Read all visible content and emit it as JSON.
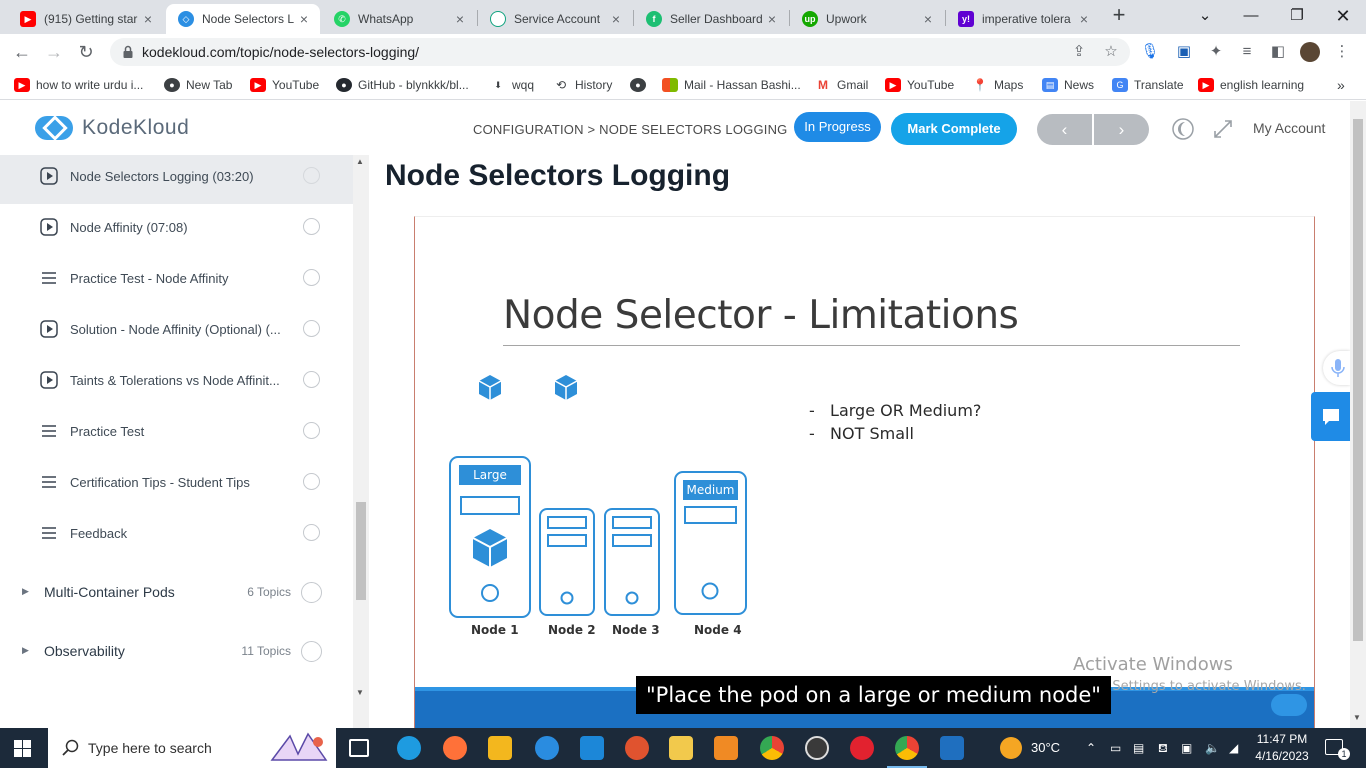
{
  "browser": {
    "tabs": [
      {
        "title": "(915) Getting star",
        "icon": "youtube-icon",
        "color": "#ff0000"
      },
      {
        "title": "Node Selectors L",
        "icon": "kodekloud-icon",
        "color": "#2c8fe3"
      },
      {
        "title": "WhatsApp",
        "icon": "whatsapp-icon",
        "color": "#25d366"
      },
      {
        "title": "Service Account",
        "icon": "openai-icon",
        "color": "#10a37f"
      },
      {
        "title": "Seller Dashboard",
        "icon": "fiverr-icon",
        "color": "#1dbf73"
      },
      {
        "title": "Upwork",
        "icon": "upwork-icon",
        "color": "#14a800"
      },
      {
        "title": "imperative tolera",
        "icon": "yahoo-icon",
        "color": "#6001d2"
      }
    ],
    "url": "kodekloud.com/topic/node-selectors-logging/",
    "bookmarks": [
      {
        "label": "how to write urdu i...",
        "icon": "youtube-icon"
      },
      {
        "label": "New Tab",
        "icon": "globe-icon"
      },
      {
        "label": "YouTube",
        "icon": "youtube-icon"
      },
      {
        "label": "GitHub - blynkkk/bl...",
        "icon": "github-icon"
      },
      {
        "label": "wqq",
        "icon": "download-icon"
      },
      {
        "label": "History",
        "icon": "history-icon"
      },
      {
        "label": "",
        "icon": "globe-icon"
      },
      {
        "label": "Mail - Hassan Bashi...",
        "icon": "microsoft-icon"
      },
      {
        "label": "Gmail",
        "icon": "gmail-icon"
      },
      {
        "label": "YouTube",
        "icon": "youtube-icon"
      },
      {
        "label": "Maps",
        "icon": "maps-icon"
      },
      {
        "label": "News",
        "icon": "news-icon"
      },
      {
        "label": "Translate",
        "icon": "translate-icon"
      },
      {
        "label": "english learning",
        "icon": "youtube-icon"
      }
    ]
  },
  "header": {
    "logo": "KodeKloud",
    "breadcrumb": "CONFIGURATION > NODE SELECTORS LOGGING",
    "status_button": "In Progress",
    "complete_button": "Mark Complete",
    "prev": "‹",
    "next": "›",
    "account": "My Account"
  },
  "sidebar": {
    "items": [
      {
        "label": "Node Selectors Logging (03:20)",
        "type": "video",
        "active": true
      },
      {
        "label": "Node Affinity (07:08)",
        "type": "video"
      },
      {
        "label": "Practice Test - Node Affinity",
        "type": "lab"
      },
      {
        "label": "Solution - Node Affinity (Optional) (...",
        "type": "video"
      },
      {
        "label": "Taints & Tolerations vs Node Affinit...",
        "type": "video"
      },
      {
        "label": "Practice Test",
        "type": "lab"
      },
      {
        "label": "Certification Tips - Student Tips",
        "type": "lab"
      },
      {
        "label": "Feedback",
        "type": "lab"
      }
    ],
    "sections": [
      {
        "label": "Multi-Container Pods",
        "count": "6 Topics"
      },
      {
        "label": "Observability",
        "count": "11 Topics"
      }
    ]
  },
  "main": {
    "title": "Node Selectors Logging",
    "slide": {
      "title": "Node Selector - Limitations",
      "bullets": [
        "Large OR Medium?",
        "NOT Small"
      ],
      "large_tag": "Large",
      "medium_tag": "Medium",
      "nodes": [
        "Node 1",
        "Node 2",
        "Node 3",
        "Node 4"
      ]
    },
    "watermark": {
      "line1": "Activate Windows",
      "line2": "Go to Settings to activate Windows."
    },
    "caption": "\"Place the pod on a large or medium node\""
  },
  "taskbar": {
    "search_placeholder": "Type here to search",
    "temperature": "30°C",
    "time": "11:47 PM",
    "date": "4/16/2023",
    "notification_count": "1"
  }
}
